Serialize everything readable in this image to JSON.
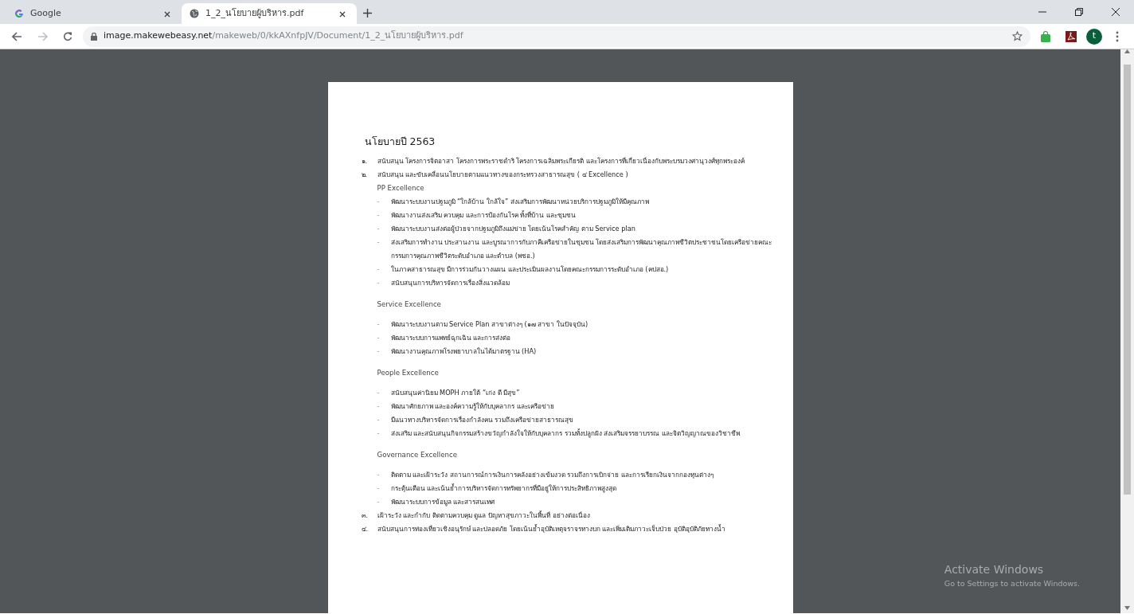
{
  "tabs": [
    {
      "title": "Google",
      "kind": "google",
      "selected": false
    },
    {
      "title": "1_2_นโยบายผู้บริหาร.pdf",
      "kind": "globe",
      "selected": true
    }
  ],
  "address": {
    "host": "image.makewebeasy.net",
    "path": "/makeweb/0/kkAXnfpJV/Document/1_2_นโยบายผู้บริหาร.pdf"
  },
  "profile": {
    "initial": "t"
  },
  "document": {
    "title": "นโยบายปี  2563",
    "items": [
      {
        "marker": "๑.",
        "text": "สนับสนุน โครงการจิตอาสา โครงการพระราชดำริ โครงการเฉลิมพระเกียรติ และโครงการที่เกี่ยวเนื่องกับพระบรมวงศานุวงศ์ทุกพระองค์"
      },
      {
        "marker": "๒.",
        "text": "สนับสนุน และขับเคลื่อนนโยบายตามแนวทางของกระทรวงสาธารณสุข ( ๔ Excellence )",
        "sections": [
          {
            "heading": "PP Excellence",
            "bullets": [
              {
                "marker": "-",
                "text": "พัฒนาระบบงานปฐมภูมิ “ใกล้บ้าน ใกล้ใจ” ส่งเสริมการพัฒนาหน่วยบริการปฐมภูมิให้มีคุณภาพ"
              },
              {
                "marker": "-",
                "text": "พัฒนางานส่งเสริม ควบคุม และการป้องกันโรค ทั้งที่บ้าน และชุมชน"
              },
              {
                "marker": "-",
                "text": "พัฒนาระบบงานส่งต่อผู้ป่วยจากปฐมภูมิถึงแม่ข่าย โดยเน้นโรคสำคัญ ตาม Service plan"
              },
              {
                "marker": "-",
                "text": "ส่งเสริมการทำงาน ประสานงาน และบูรณาการกับภาคีเครือข่ายในชุมชน โดยส่งเสริมการพัฒนาคุณภาพชีวิตประชาชนโดยเครือข่ายคณะกรรมการคุณภาพชีวิตระดับอำเภอ และตำบล (พชอ.)"
              },
              {
                "marker": "-",
                "text": "ในภาคสาธารณสุข มีการร่วมกันวางแผน และประเมินผลงานโดยคณะกรรมการระดับอำเภอ (คปสอ.)"
              },
              {
                "marker": "-",
                "text": "สนับสนุนการบริหารจัดการเรื่องสิ่งแวดล้อม"
              }
            ]
          },
          {
            "heading": "Service Excellence",
            "bullets": [
              {
                "marker": "-",
                "text": "พัฒนาระบบงานตาม Service Plan สาขาต่างๆ (๑๗ สาขา ในปัจจุบัน)"
              },
              {
                "marker": "-",
                "text": "พัฒนาระบบการแพทย์ฉุกเฉิน และการส่งต่อ"
              },
              {
                "marker": "-",
                "text": "พัฒนางานคุณภาพโรงพยาบาลในได้มาตรฐาน (HA)"
              }
            ]
          },
          {
            "heading": "People Excellence",
            "bullets": [
              {
                "marker": "-",
                "text": "สนับสนุนค่านิยม MOPH  ภายใต้ “เก่ง ดี มีสุข”"
              },
              {
                "marker": "-",
                "text": "พัฒนาศักยภาพ และองค์ความรู้ให้กับบุคลากร และเครือข่าย"
              },
              {
                "marker": "-",
                "text": "มีแนวทางบริหารจัดการเรื่องกำลังคน รวมถึงเครือข่ายสาธารณสุข"
              },
              {
                "marker": "-",
                "text": "ส่งเสริม และสนับสนุนกิจกรรมสร้างขวัญกำลังใจให้กับบุคลากร รวมทั้งปลูกฝัง ส่งเสริมจรรยาบรรณ และจิตวิญญาณของวิชาชีพ"
              }
            ]
          },
          {
            "heading": "Governance Excellence",
            "bullets": [
              {
                "marker": "-",
                "text": "ติดตาม และเฝ้าระวัง สถานการณ์การเงินการคลังอย่างเข้มงวด รวมถึงการเบิกจ่าย และการเรียกเงินจากกองทุนต่างๆ"
              },
              {
                "marker": "-",
                "text": "กระตุ้นเตือน และเน้นย้ำการบริหารจัดการทรัพยากรที่มีอยู่ให้การประสิทธิภาพสูงสุด"
              },
              {
                "marker": "-",
                "text": "พัฒนาระบบการข้อมูล และสารสนเทศ"
              }
            ]
          }
        ]
      },
      {
        "marker": "๓.",
        "text": "เฝ้าระวัง และกำกับ ติดตามควบคุม ดูแล ปัญหาสุขภาวะในพื้นที่ อย่างต่อเนื่อง"
      },
      {
        "marker": "๔.",
        "text": "สนับสนุนการท่องเที่ยวเชิงอนุรักษ์ และปลอดภัย โดยเน้นย้ำอุบัติเหตุจราจรทางบก และเพิ่มเติมภาวะเจ็บป่วย อุบัติอุบัติภัยทางน้ำ"
      }
    ]
  },
  "activation": {
    "title": "Activate Windows",
    "subtitle": "Go to Settings to activate Windows."
  }
}
